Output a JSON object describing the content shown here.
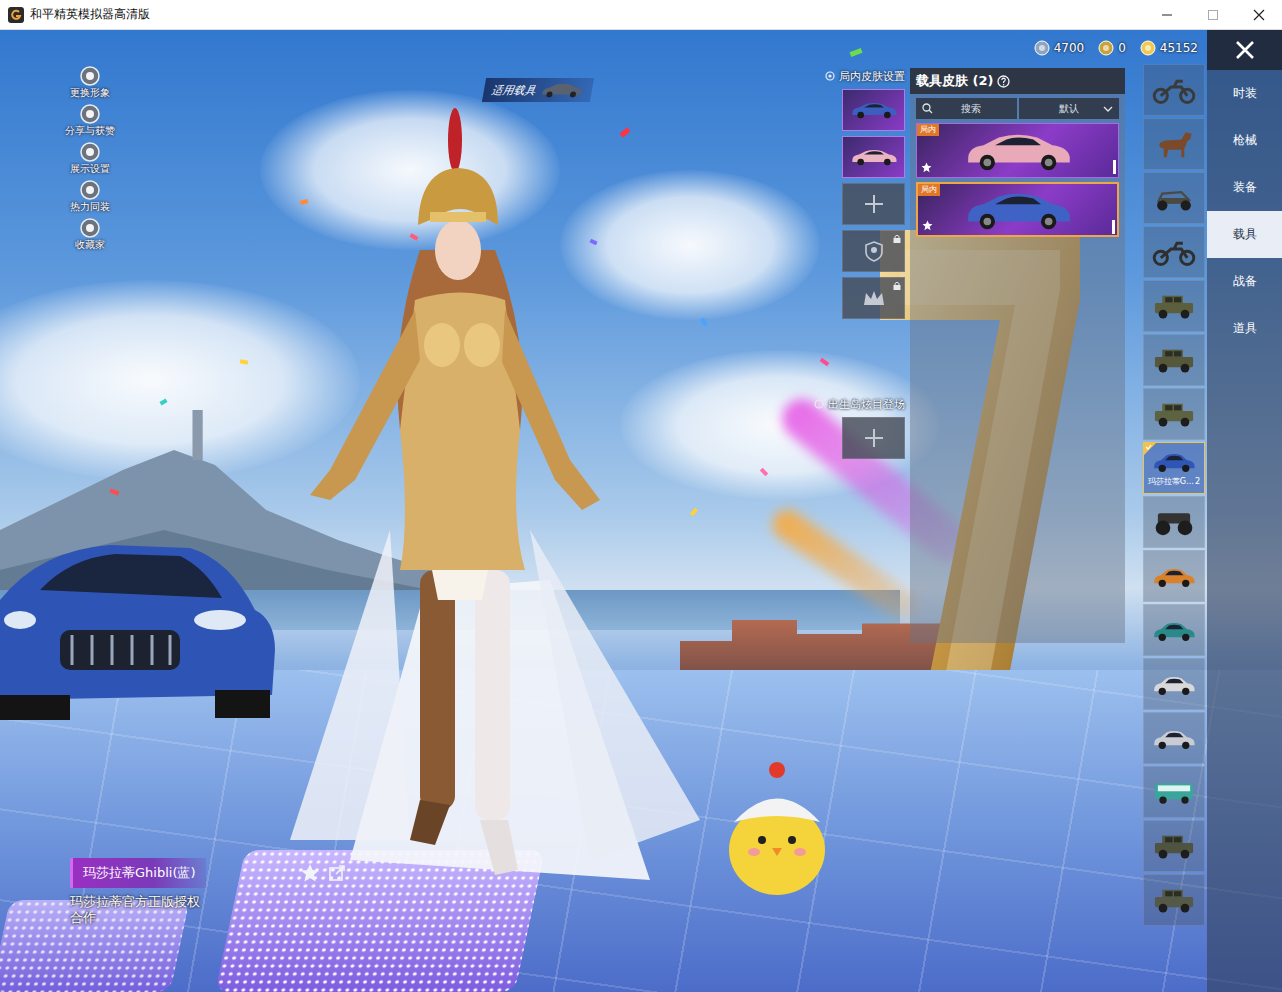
{
  "window": {
    "title": "和平精英模拟器高清版"
  },
  "currency": [
    {
      "amount": "4700",
      "color": "#8ea4bf"
    },
    {
      "amount": "0",
      "color": "#c9a23a"
    },
    {
      "amount": "45152",
      "color": "#f0c94c"
    }
  ],
  "left_menu": [
    {
      "label": "更换形象"
    },
    {
      "label": "分享与获赞"
    },
    {
      "label": "展示设置"
    },
    {
      "label": "热力同装"
    },
    {
      "label": "收藏家"
    }
  ],
  "vehicle_tag": "适用载具",
  "skin_settings": {
    "title": "局内皮肤设置",
    "slots": [
      {
        "kind": "skin",
        "color": "#3a5fc0"
      },
      {
        "kind": "skin",
        "color": "#eab4c2"
      },
      {
        "kind": "add"
      },
      {
        "kind": "emblem"
      },
      {
        "kind": "crown"
      }
    ]
  },
  "spawn": {
    "title": "出生岛炫目登场"
  },
  "skin_panel": {
    "title": "载具皮肤 (2)",
    "search": "搜索",
    "sort": "默认",
    "cards": [
      {
        "tag": "局内",
        "color": "#e8aab9",
        "selected": false
      },
      {
        "tag": "局内",
        "color": "#3f63c4",
        "selected": true
      }
    ]
  },
  "tabs": [
    {
      "label": "时装",
      "selected": false
    },
    {
      "label": "枪械",
      "selected": false
    },
    {
      "label": "装备",
      "selected": false
    },
    {
      "label": "载具",
      "selected": true
    },
    {
      "label": "战备",
      "selected": false
    },
    {
      "label": "道具",
      "selected": false
    }
  ],
  "vehicles": [
    {
      "kind": "bike",
      "color": "#3a3a3a",
      "selected": false
    },
    {
      "kind": "horse",
      "color": "#7a4a2a",
      "selected": false
    },
    {
      "kind": "buggy",
      "color": "#4a4a42",
      "selected": false
    },
    {
      "kind": "bike",
      "color": "#2f2f2f",
      "selected": false
    },
    {
      "kind": "jeep",
      "color": "#5b5f3d",
      "selected": false
    },
    {
      "kind": "jeep",
      "color": "#55583a",
      "selected": false
    },
    {
      "kind": "jeep",
      "color": "#5d6240",
      "selected": false
    },
    {
      "kind": "car",
      "color": "#2f56b5",
      "selected": true,
      "label": "玛莎拉蒂G...",
      "count": "2"
    },
    {
      "kind": "truck",
      "color": "#333333",
      "selected": false
    },
    {
      "kind": "car",
      "color": "#d9822b",
      "selected": false
    },
    {
      "kind": "car",
      "color": "#2a8a8a",
      "selected": false
    },
    {
      "kind": "car",
      "color": "#d8d8d8",
      "selected": false
    },
    {
      "kind": "car",
      "color": "#c9ccd3",
      "selected": false
    },
    {
      "kind": "bus",
      "color": "#3aa59a",
      "selected": false
    },
    {
      "kind": "jeep",
      "color": "#4e5440",
      "selected": false
    },
    {
      "kind": "jeep",
      "color": "#555a48",
      "selected": false
    }
  ],
  "vehicle_info": {
    "name": "玛莎拉蒂Ghibli(蓝)",
    "license": "玛莎拉蒂官方正版授权合作"
  }
}
